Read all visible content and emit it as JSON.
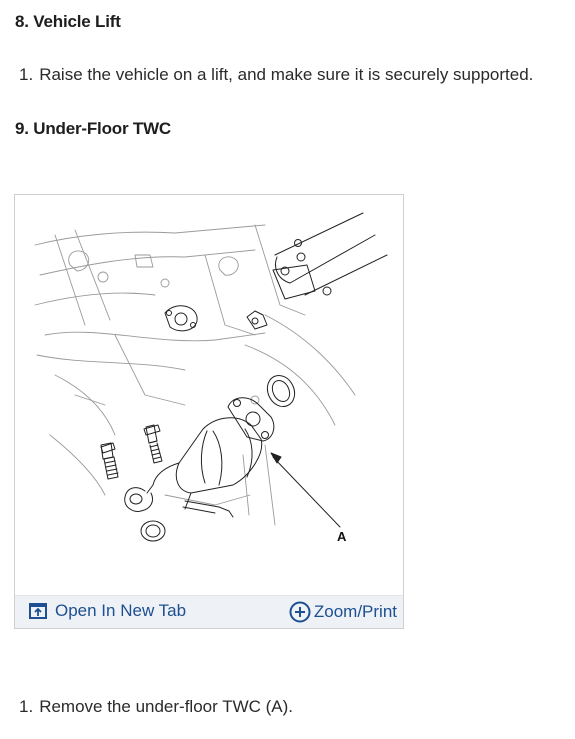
{
  "sections": [
    {
      "heading": "8. Vehicle Lift",
      "step_number": "1.",
      "step_text": "Raise the vehicle on a lift, and make sure it is securely supported."
    },
    {
      "heading": "9. Under-Floor TWC"
    }
  ],
  "figure": {
    "callout_label": "A",
    "open_link_label": "Open In New Tab",
    "zoom_link_label": "Zoom/Print",
    "open_icon": "open-in-new-tab-icon",
    "zoom_icon": "plus-circle-icon",
    "link_color": "#1d4f91"
  },
  "final_step": {
    "step_number": "1.",
    "step_text": "Remove the under-floor TWC (A)."
  }
}
